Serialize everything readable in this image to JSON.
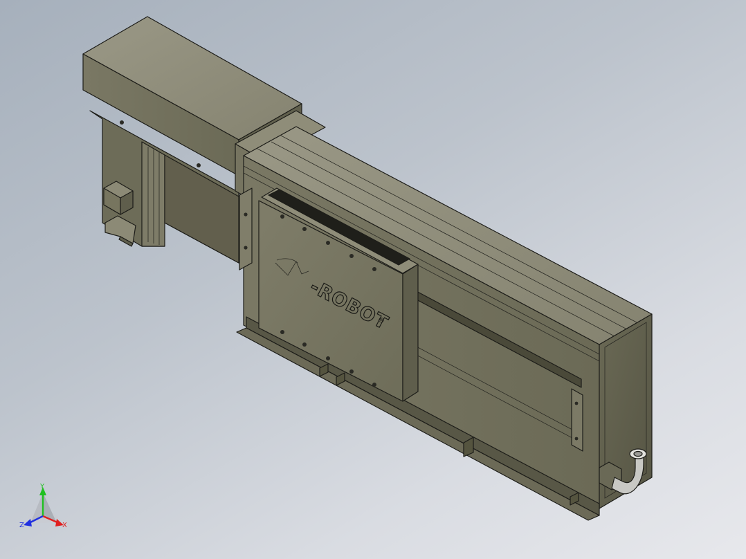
{
  "model": {
    "brand_text": "-ROBOT",
    "registered_mark": "®"
  },
  "triad": {
    "x_label": "X",
    "y_label": "Y",
    "z_label": "Z",
    "x_color": "#e02020",
    "y_color": "#20c020",
    "z_color": "#2030e0"
  },
  "colors": {
    "body_light": "#8e8c7c",
    "body_mid": "#76745f",
    "body_dark": "#5a5948",
    "edge": "#1d1d19"
  }
}
